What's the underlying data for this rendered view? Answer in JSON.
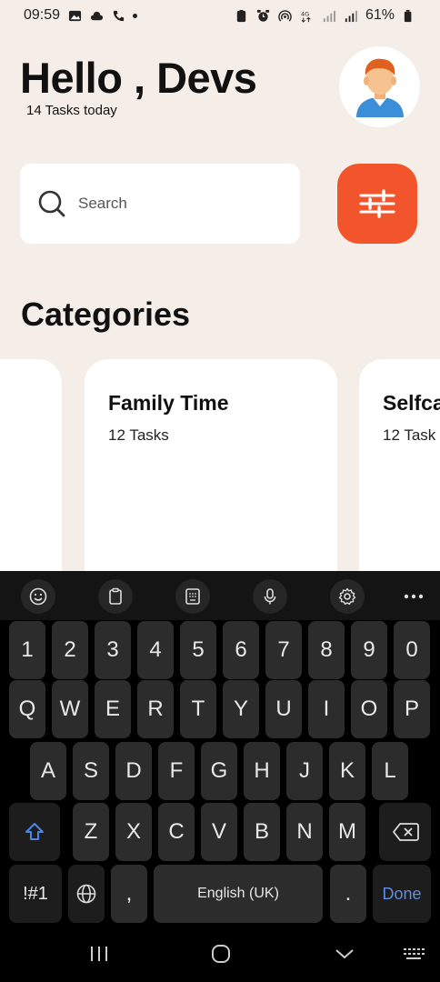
{
  "status_bar": {
    "time": "09:59",
    "battery": "61%"
  },
  "header": {
    "greeting": "Hello , Devs",
    "subtitle": "14 Tasks today"
  },
  "search": {
    "placeholder": "Search",
    "value": ""
  },
  "categories": {
    "title": "Categories",
    "cards": [
      {
        "title": "",
        "count": ""
      },
      {
        "title": "Family Time",
        "count": "12 Tasks"
      },
      {
        "title": "Selfca",
        "count": "12 Task"
      }
    ]
  },
  "keyboard": {
    "row_numbers": [
      "1",
      "2",
      "3",
      "4",
      "5",
      "6",
      "7",
      "8",
      "9",
      "0"
    ],
    "row_top": [
      "Q",
      "W",
      "E",
      "R",
      "T",
      "Y",
      "U",
      "I",
      "O",
      "P"
    ],
    "row_middle": [
      "A",
      "S",
      "D",
      "F",
      "G",
      "H",
      "J",
      "K",
      "L"
    ],
    "row_bottom": [
      "Z",
      "X",
      "C",
      "V",
      "B",
      "N",
      "M"
    ],
    "symbols_label": "!#1",
    "comma_label": ",",
    "space_label": "English (UK)",
    "period_label": ".",
    "done_label": "Done"
  },
  "colors": {
    "accent": "#f2552c",
    "background": "#f5eee8",
    "done_blue": "#5d8ee8"
  }
}
